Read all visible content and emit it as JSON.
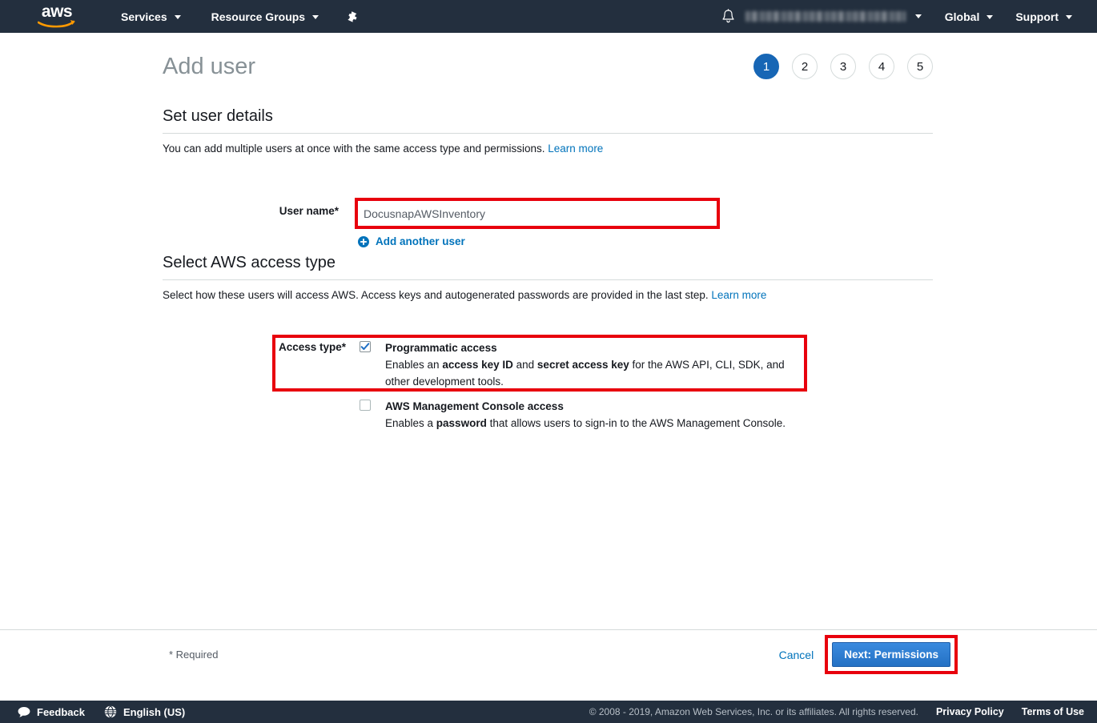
{
  "topnav": {
    "logo_text": "aws",
    "logo_alt": "aws-logo",
    "services_label": "Services",
    "resource_groups_label": "Resource Groups",
    "pin_icon": "pin-icon",
    "bell_icon": "bell-icon",
    "account_label": "",
    "global_label": "Global",
    "support_label": "Support"
  },
  "header": {
    "title": "Add user",
    "steps": [
      {
        "number": "1",
        "active": true
      },
      {
        "number": "2",
        "active": false
      },
      {
        "number": "3",
        "active": false
      },
      {
        "number": "4",
        "active": false
      },
      {
        "number": "5",
        "active": false
      }
    ]
  },
  "user_details": {
    "section_title": "Set user details",
    "description": "You can add multiple users at once with the same access type and permissions.",
    "learn_more": "Learn more",
    "username_label": "User name*",
    "username_value": "DocusnapAWSInventory",
    "username_placeholder": "",
    "add_another_label": "Add another user",
    "plus_icon": "plus-circle-icon"
  },
  "access_type": {
    "section_title": "Select AWS access type",
    "description": "Select how these users will access AWS. Access keys and autogenerated passwords are provided in the last step.",
    "learn_more": "Learn more",
    "access_type_label": "Access type*",
    "options": [
      {
        "title": "Programmatic access",
        "checked": true,
        "desc_parts": [
          {
            "text": "Enables an ",
            "bold": false
          },
          {
            "text": "access key ID",
            "bold": true
          },
          {
            "text": " and ",
            "bold": false
          },
          {
            "text": "secret access key",
            "bold": true
          },
          {
            "text": " for the AWS API, CLI, SDK, and other development tools.",
            "bold": false
          }
        ]
      },
      {
        "title": "AWS Management Console access",
        "checked": false,
        "desc_parts": [
          {
            "text": "Enables a ",
            "bold": false
          },
          {
            "text": "password",
            "bold": true
          },
          {
            "text": " that allows users to sign-in to the AWS Management Console.",
            "bold": false
          }
        ]
      }
    ]
  },
  "actionbar": {
    "required_note": "* Required",
    "cancel_label": "Cancel",
    "next_label": "Next: Permissions"
  },
  "footer": {
    "feedback_label": "Feedback",
    "feedback_icon": "speech-bubble-icon",
    "language_label": "English (US)",
    "language_icon": "globe-icon",
    "copyright": "© 2008 - 2019, Amazon Web Services, Inc. or its affiliates. All rights reserved.",
    "privacy_label": "Privacy Policy",
    "terms_label": "Terms of Use"
  },
  "colors": {
    "nav_background": "#232f3e",
    "accent_blue": "#0073bb",
    "active_step": "#1766b5",
    "highlight_red": "#e8000d",
    "button_blue": "#2d7dd2",
    "logo_orange": "#ff9900"
  }
}
